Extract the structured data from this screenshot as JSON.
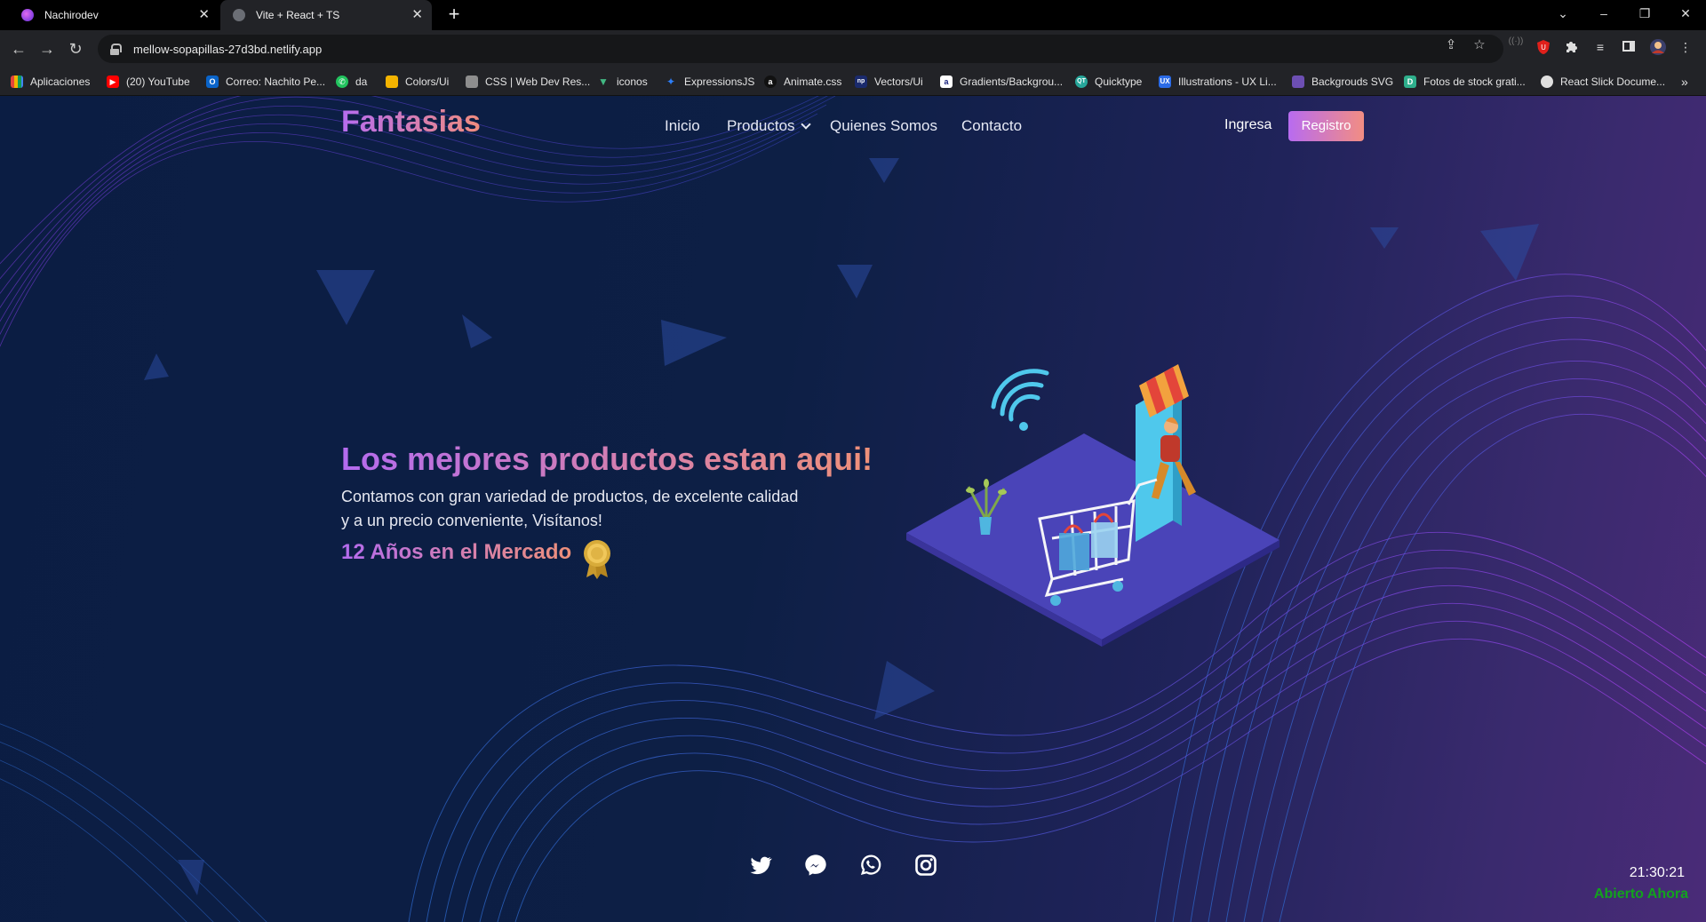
{
  "browser": {
    "tabs": [
      {
        "title": "Nachirodev",
        "active": false,
        "favicon_color": "#7b3fe4"
      },
      {
        "title": "Vite + React + TS",
        "active": true,
        "favicon_color": "#6b6e75"
      }
    ],
    "address": "mellow-sopapillas-27d3bd.netlify.app",
    "bookmarks": [
      {
        "label": "Aplicaciones",
        "icon": "apps-grid-icon",
        "color": "#e5a33b"
      },
      {
        "label": "(20) YouTube",
        "icon": "youtube-icon",
        "color": "#ff0000"
      },
      {
        "label": "Correo: Nachito Pe...",
        "icon": "outlook-icon",
        "color": "#0a64c9"
      },
      {
        "label": "da",
        "icon": "whatsapp-icon",
        "color": "#22c35e"
      },
      {
        "label": "Colors/Ui",
        "icon": "colors-icon",
        "color": "#f4b400"
      },
      {
        "label": "CSS | Web Dev Res...",
        "icon": "css-icon",
        "color": "#8e8e8e"
      },
      {
        "label": "iconos",
        "icon": "vue-icon",
        "color": "#42b883"
      },
      {
        "label": "ExpressionsJS",
        "icon": "expressions-icon",
        "color": "#2d7ff9"
      },
      {
        "label": "Animate.css",
        "icon": "animate-icon",
        "color": "#111111"
      },
      {
        "label": "Vectors/Ui",
        "icon": "vectors-icon",
        "color": "#1a2a6c"
      },
      {
        "label": "Gradients/Backgrou...",
        "icon": "gradients-icon",
        "color": "#ffffff"
      },
      {
        "label": "Quicktype",
        "icon": "quicktype-icon",
        "color": "#26a69a"
      },
      {
        "label": "Illustrations - UX Li...",
        "icon": "ux-icon",
        "color": "#2b6be6"
      },
      {
        "label": "Backgrouds SVG",
        "icon": "svg-bg-icon",
        "color": "#6d4fb3"
      },
      {
        "label": "Fotos de stock grati...",
        "icon": "stock-photo-icon",
        "color": "#2eaf8c"
      },
      {
        "label": "React Slick Docume...",
        "icon": "globe-icon",
        "color": "#e0e0e0"
      }
    ]
  },
  "site": {
    "brand": "Fantasias",
    "nav": [
      "Inicio",
      "Productos",
      "Quienes Somos",
      "Contacto"
    ],
    "login_label": "Ingresa",
    "register_label": "Registro",
    "hero": {
      "title": "Los mejores productos estan aqui!",
      "subtitle_line1": "Contamos con gran variedad de productos, de excelente calidad",
      "subtitle_line2": "y a un precio conveniente, Visítanos!",
      "years": "12 Años en el Mercado"
    },
    "social": [
      "twitter-icon",
      "messenger-icon",
      "whatsapp-icon",
      "instagram-icon"
    ],
    "clock": "21:30:21",
    "status": "Abierto Ahora"
  },
  "colors": {
    "brand_gradient_start": "#b46bef",
    "brand_gradient_end": "#ef9079",
    "status_open": "#12a31d",
    "page_bg": "#0d1f45"
  }
}
